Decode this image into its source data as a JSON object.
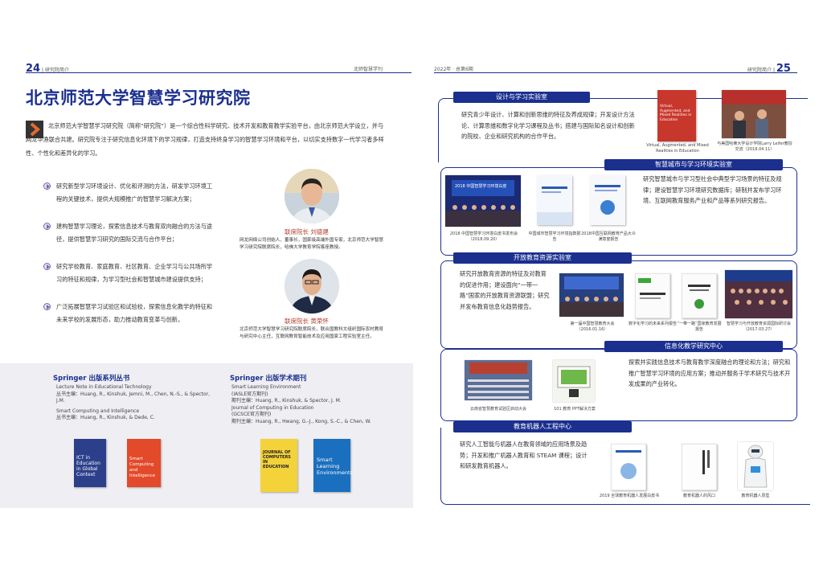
{
  "left": {
    "page_number": "24",
    "header_left": "研究院简介",
    "header_right": "北师智慧学刊",
    "title": "北京师范大学智慧学习研究院",
    "intro": "北京师范大学智慧学习研究院（简称“研究院”）是一个综合性科学研究、技术开发和教育教学实验平台，由北京师范大学设立，并与网龙华渔联合共建。研究院专注于研究信息化环境下的学习规律，打造支持终身学习的智慧学习环境和平台，以切实支持数字一代学习者多样性、个性化和差异化的学习。",
    "bullets": [
      "研究新型学习环境设计、优化和评测的方法，研发学习环境工程的关键技术，提供大规模推广的智慧学习解决方案；",
      "建构智慧学习理论，探索信息技术与教育双向融合的方法与途径，提供智慧学习研究的国际交流与合作平台；",
      "研究学校教育、家庭教育、社区教育、企业学习与公共场所学习的特征和规律，为学习型社会和智慧城市建设提供支持；",
      "广泛拓展智慧学习试验区和试验校，探索信息化教学的特征和未来学校的发展形态，助力推动教育变革与创新。"
    ],
    "person1": {
      "name": "联席院长 刘德建",
      "desc": "网龙网络公司创始人、董事长，国家级高端外国专家，北京师范大学智慧学习研究院联席院长，哈佛大学教育学院客座教授。"
    },
    "person2": {
      "name": "联席院长 黄荣怀",
      "desc": "北京师范大学智慧学习研究院联席院长，联合国教科文组织国际农村教育与研究中心主任，互联网教育智能技术及应用国家工程实验室主任。"
    },
    "springer_series": {
      "title": "Springer 出版系列丛书",
      "items": [
        "Lecture Note in Educational Technology",
        "丛书主编：Huang, R., Kinshuk, Jemni, M., Chen, N.-S., & Spector, J.M.",
        "Smart Computing and Intelligence",
        "丛书主编：Huang, R., Kinshuk, & Dede, C."
      ],
      "books": [
        "ICT in Education in Global Context",
        "Smart Computing and Intelligence"
      ]
    },
    "springer_journals": {
      "title": "Springer 出版学术期刊",
      "items": [
        "Smart Learning Environment",
        "(IASLE官方期刊)",
        "期刊主编：Huang, R., Kinshuk, & Spector, J. M.",
        "Journal of Computing in Education",
        "(GCSCE官方期刊)",
        "期刊主编：Huang, R., Hwang, G.-J., Kong, S.-C., & Chen, W."
      ],
      "books": [
        "JOURNAL OF COMPUTERS IN EDUCATION",
        "Smart Learning Environments"
      ]
    }
  },
  "right": {
    "page_number": "25",
    "header_left": "2022年 · 总第6期",
    "header_right": "研究院简介",
    "sections": [
      {
        "title": "设计与学习实验室",
        "text": "研究青少年设计、计算和创新思维的特征及养成规律；开发设计方法论、计算思维和数字化学习课程及丛书；搭建与国际知名设计和创新的院校、企业和研究机构的合作平台。",
        "captions": [
          "Virtual, Augmented, and Mixed Realities in Education",
          "与美国哈佛大学设计学院Larry Leifer教授交流（2018.04.11）"
        ],
        "book_title": "Virtual, Augmented, and Mixed Realities in Education"
      },
      {
        "title": "智慧城市与学习环境实验室",
        "text": "研究智慧城市与学习型社会中典型学习场景的特征及规律；建设智慧学习环境研究数据库；研制并发布学习环境、互联网教育服务产业和产品等系列研究报告。",
        "captions": [
          "2018 中国智慧学习环境白皮书发布会（2018.09.20）",
          "中国城市智慧学习环境指数报告",
          "2018中国互联网教育产品大众满意度报告"
        ],
        "banner": "2018 中国智慧学习环境白皮"
      },
      {
        "title": "开放教育资源实验室",
        "text": "研究开放教育资源的特征及对教育的促进作用；建设面向“一带一路”国家的开放教育资源联盟；研究并发布教育信息化趋势报告。",
        "captions": [
          "第一届中国智慧教育大会（2016.01.16）",
          "数字化学习的未来系列报告",
          "“一带一路”国家教育发展报告",
          "智慧学习与开放教育资源国际研讨会（2017.03.27）"
        ]
      },
      {
        "title": "信息化教学研究中心",
        "text": "探索并实践信息技术与教育教学深度融合的理论和方法；研究和推广智慧学习环境的应用方案；推动并服务于学术研究与技术开发成果的产业转化。",
        "captions": [
          "云南省智慧教育试验区启动大会",
          "101 教育 PPT解决方案"
        ]
      },
      {
        "title": "教育机器人工程中心",
        "text": "研究人工智能与机器人在教育领域的应用场景及趋势；开发和推广机器人教育和 STEAM 课程；设计和研发教育机器人。",
        "captions": [
          "2019 全球教育机器人发展白皮书",
          "教育机器人的风口",
          "教育机器人原型"
        ]
      }
    ]
  },
  "colors": {
    "brand_blue": "#1b2f8f",
    "name_red": "#b23c2a",
    "gray_band": "#eeeef3"
  }
}
